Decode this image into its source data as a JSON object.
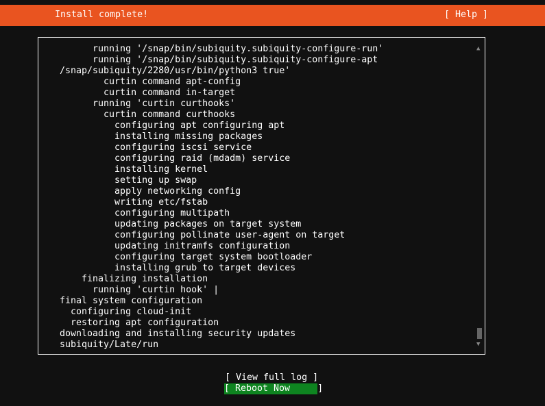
{
  "header": {
    "title": "Install complete!",
    "help_label": "[ Help ]"
  },
  "log": {
    "lines": [
      "      running '/snap/bin/subiquity.subiquity-configure-run'",
      "      running '/snap/bin/subiquity.subiquity-configure-apt",
      "/snap/subiquity/2280/usr/bin/python3 true'",
      "        curtin command apt-config",
      "        curtin command in-target",
      "      running 'curtin curthooks'",
      "        curtin command curthooks",
      "          configuring apt configuring apt",
      "          installing missing packages",
      "          configuring iscsi service",
      "          configuring raid (mdadm) service",
      "          installing kernel",
      "          setting up swap",
      "          apply networking config",
      "          writing etc/fstab",
      "          configuring multipath",
      "          updating packages on target system",
      "          configuring pollinate user-agent on target",
      "          updating initramfs configuration",
      "          configuring target system bootloader",
      "          installing grub to target devices",
      "    finalizing installation",
      "      running 'curtin hook' |",
      "final system configuration",
      "  configuring cloud-init",
      "  restoring apt configuration",
      "downloading and installing security updates",
      "subiquity/Late/run"
    ],
    "scroll_up_icon": "▲",
    "scroll_down_icon": "▼"
  },
  "buttons": {
    "view_log": "[ View full log ]",
    "reboot": "[ Reboot Now     ]"
  },
  "colors": {
    "accent": "#e95420",
    "reboot_bg": "#0e8420",
    "background": "#111111"
  }
}
